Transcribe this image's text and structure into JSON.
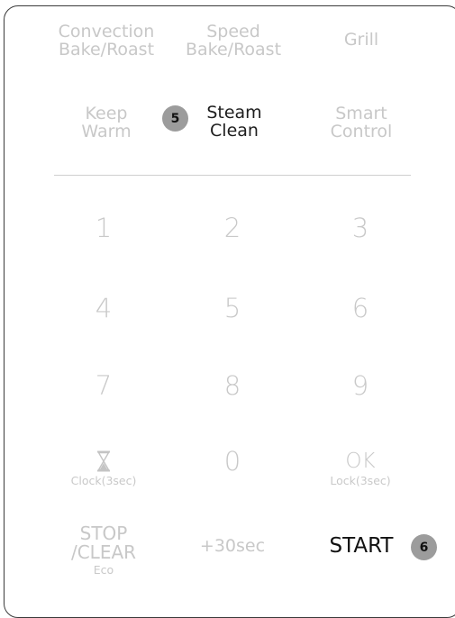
{
  "function_keys": {
    "convection": [
      "Convection",
      "Bake/Roast"
    ],
    "speed": [
      "Speed",
      "Bake/Roast"
    ],
    "grill": "Grill",
    "keep_warm": [
      "Keep",
      "Warm"
    ],
    "steam_clean": [
      "Steam",
      "Clean"
    ],
    "smart_control": [
      "Smart",
      "Control"
    ]
  },
  "badges": {
    "steam_clean": "5",
    "start": "6"
  },
  "number_keys": [
    "1",
    "2",
    "3",
    "4",
    "5",
    "6",
    "7",
    "8",
    "9",
    "0"
  ],
  "clock": {
    "sub": "Clock(3sec)",
    "icon": "hourglass-icon"
  },
  "ok": {
    "label": "OK",
    "sub": "Lock(3sec)"
  },
  "stop": {
    "line1": "STOP",
    "line2": "/CLEAR",
    "sub": "Eco"
  },
  "plus30": "+30sec",
  "start": "START",
  "colors": {
    "active_text": "#1e1e1e",
    "inactive_text": "#c8c8c8",
    "badge_bg": "#9c9c9c"
  }
}
